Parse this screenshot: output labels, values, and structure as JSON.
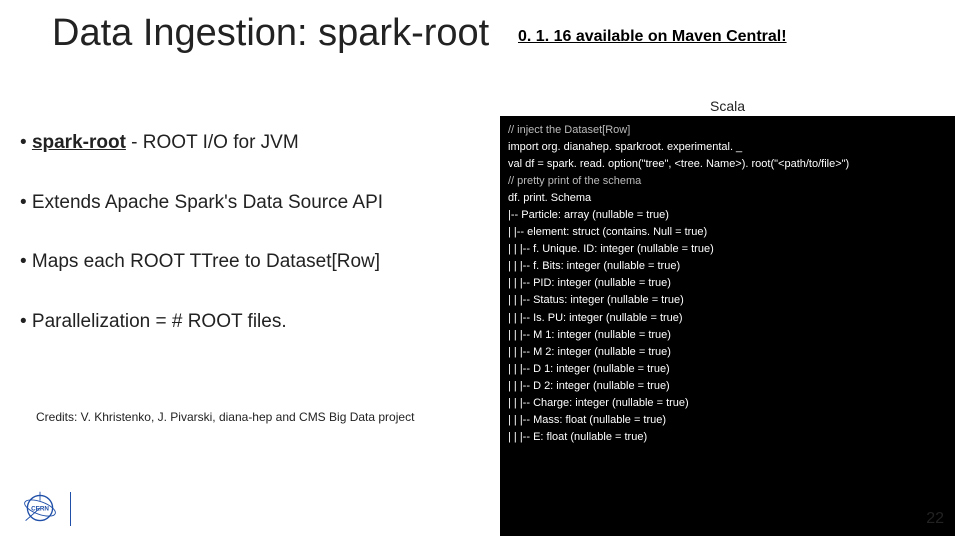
{
  "title": "Data Ingestion: spark-root",
  "maven_note": "0. 1. 16 available on Maven Central!",
  "scala_label": "Scala",
  "bullets": {
    "b1_prefix": "• ",
    "b1_link": "spark-root",
    "b1_rest": " - ROOT I/O for JVM",
    "b2": "• Extends Apache Spark's Data Source API",
    "b3": "• Maps each ROOT TTree to Dataset[Row]",
    "b4": "• Parallelization = # ROOT files."
  },
  "credits": "Credits: V. Khristenko, J. Pivarski, diana-hep and CMS Big Data project",
  "page_number": "22",
  "code": {
    "l1": "// inject the Dataset[Row]",
    "l2": "import org. dianahep. sparkroot. experimental. _",
    "l3": "val df = spark. read. option(\"tree\", <tree. Name>). root(\"<path/to/file>\")",
    "l4": "",
    "l5": "// pretty print of the schema",
    "l6": "df. print. Schema",
    "l7": "",
    "l8": "|-- Particle: array (nullable = true)",
    "l9": " |    |-- element: struct (contains. Null = true)",
    "l10": " |    |    |-- f. Unique. ID: integer (nullable = true)",
    "l11": " |    |    |-- f. Bits: integer (nullable = true)",
    "l12": " |    |    |-- PID: integer (nullable = true)",
    "l13": " |    |    |-- Status: integer (nullable = true)",
    "l14": " |    |    |-- Is. PU: integer (nullable = true)",
    "l15": " |    |    |-- M 1: integer (nullable = true)",
    "l16": " |    |    |-- M 2: integer (nullable = true)",
    "l17": " |    |    |-- D 1: integer (nullable = true)",
    "l18": " |    |    |-- D 2: integer (nullable = true)",
    "l19": " |    |    |-- Charge: integer (nullable = true)",
    "l20": " |    |    |-- Mass: float (nullable = true)",
    "l21": " |    |    |-- E: float (nullable = true)"
  }
}
